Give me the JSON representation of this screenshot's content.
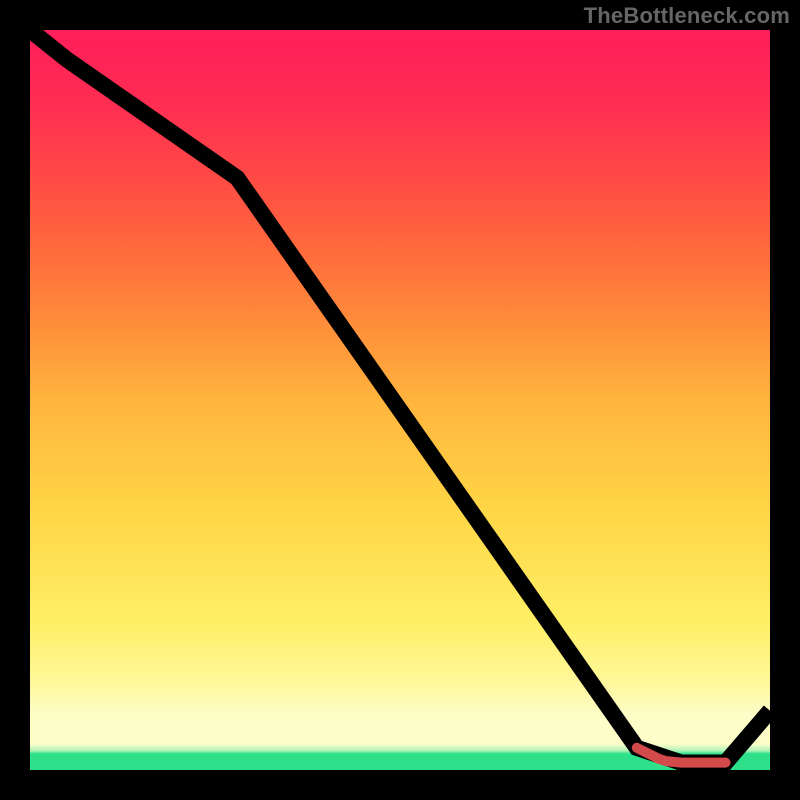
{
  "watermark": "TheBottleneck.com",
  "chart_data": {
    "type": "line",
    "title": "",
    "xlabel": "",
    "ylabel": "",
    "xlim": [
      0,
      100
    ],
    "ylim": [
      0,
      100
    ],
    "grid": false,
    "background": "vertical red-to-yellow-to-green gradient (green at bottom)",
    "series": [
      {
        "name": "curve",
        "x": [
          0,
          5,
          28,
          82,
          88,
          94,
          100
        ],
        "values": [
          100,
          96,
          80,
          3,
          1,
          1,
          8
        ],
        "stroke": "#000000"
      }
    ],
    "highlight": {
      "name": "pink-segment",
      "x": [
        82,
        84,
        85,
        86,
        88,
        90,
        92,
        94
      ],
      "values": [
        3.0,
        2.0,
        1.5,
        1.2,
        1.0,
        1.0,
        1.0,
        1.0
      ],
      "stroke": "#d24a4a",
      "stroke_width_px": 10
    }
  }
}
